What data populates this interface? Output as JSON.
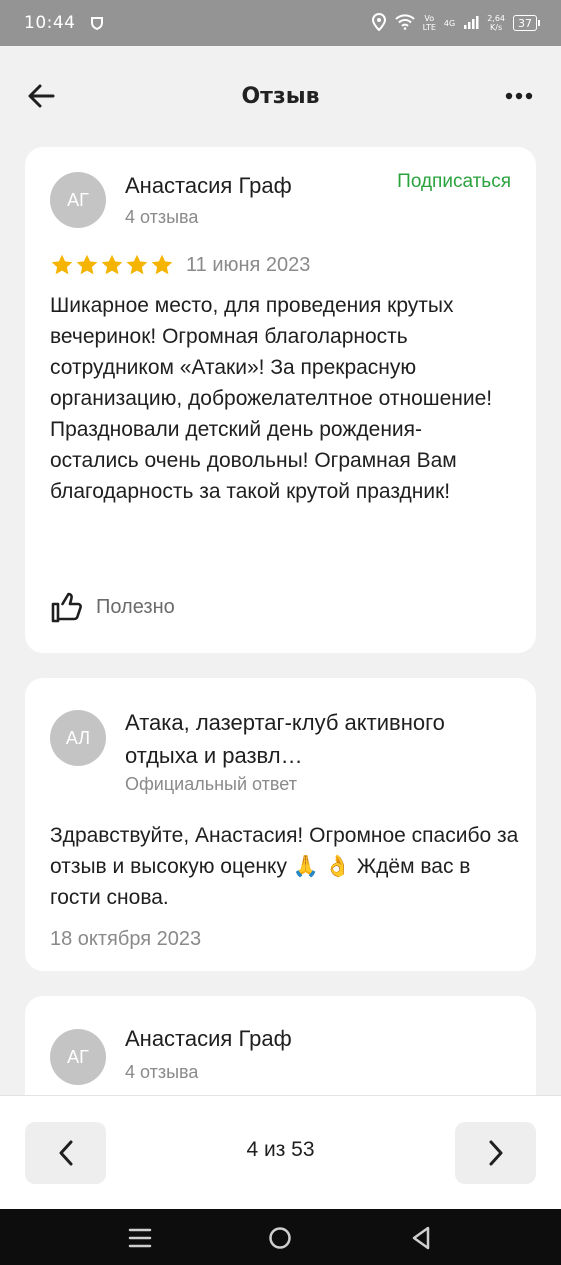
{
  "status_bar": {
    "time": "10:44",
    "network_top": "Vo",
    "network_bottom": "LTE",
    "gen": "4G",
    "speed_top": "2,64",
    "speed_bottom": "K/s",
    "battery": "37"
  },
  "header": {
    "title": "Отзыв"
  },
  "review": {
    "avatar_initials": "АГ",
    "author": "Анастасия Граф",
    "reviews_count": "4 отзыва",
    "subscribe_label": "Подписаться",
    "rating": 5,
    "rating_max": 5,
    "date": "11 июня 2023",
    "text": "Шикарное место, для проведения крутых вечеринок! Огромная благоларность сотрудником «Атаки»! За прекрасную организацию, доброжелателтное отношение! Праздновали детский день рождения- остались очень довольны! Ограмная Вам благодарность за такой крутой праздник!",
    "useful_label": "Полезно"
  },
  "reply": {
    "avatar_initials": "АЛ",
    "org_name": "Атака, лазертаг-клуб активного отдыха и развл…",
    "sub_label": "Официальный ответ",
    "text": "Здравствуйте, Анастасия! Огромное спасибо за отзыв и высокую оценку 🙏 👌 Ждём вас в гости снова.",
    "date": "18 октября 2023"
  },
  "next_review": {
    "avatar_initials": "АГ",
    "author": "Анастасия Граф",
    "reviews_count": "4 отзыва"
  },
  "pager": {
    "label": "4 из 53"
  },
  "colors": {
    "accent_green": "#2aa33d",
    "star": "#f5b400",
    "avatar": "#c4c4c4"
  },
  "icons": {
    "back": "arrow-left-icon",
    "more": "more-dots-icon",
    "useful": "thumb-up-icon",
    "prev": "chevron-left-icon",
    "next": "chevron-right-icon"
  }
}
